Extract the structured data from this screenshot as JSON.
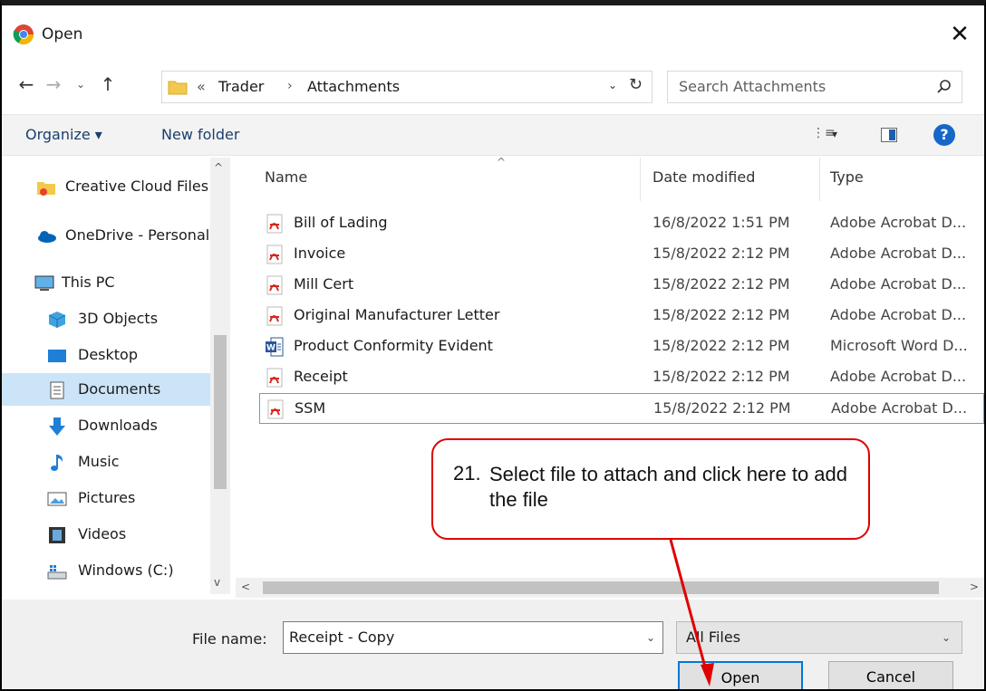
{
  "window": {
    "title": "Open",
    "close_glyph": "✕"
  },
  "address": {
    "overflow": "«",
    "path": [
      "Trader",
      "Attachments"
    ],
    "separator": "›",
    "dropdown_glyph": "⌄",
    "refresh_glyph": "↻"
  },
  "nav": {
    "back": "←",
    "forward": "→",
    "recent": "⌄",
    "up": "↑"
  },
  "search": {
    "placeholder": "Search Attachments"
  },
  "toolbar": {
    "organize": "Organize ▾",
    "new_folder": "New folder",
    "views_glyph": "⋮≡",
    "views_dd": "▾",
    "help": "?"
  },
  "sidebar": {
    "items": [
      {
        "label": "Creative Cloud Files",
        "icon": "creative-cloud-icon"
      },
      {
        "label": "OneDrive - Personal",
        "icon": "onedrive-icon"
      },
      {
        "label": "This PC",
        "icon": "pc-icon"
      },
      {
        "label": "3D Objects",
        "icon": "cube-icon"
      },
      {
        "label": "Desktop",
        "icon": "desktop-icon"
      },
      {
        "label": "Documents",
        "icon": "documents-icon"
      },
      {
        "label": "Downloads",
        "icon": "download-icon"
      },
      {
        "label": "Music",
        "icon": "music-icon"
      },
      {
        "label": "Pictures",
        "icon": "pictures-icon"
      },
      {
        "label": "Videos",
        "icon": "videos-icon"
      },
      {
        "label": "Windows (C:)",
        "icon": "drive-icon"
      }
    ],
    "selected": "Documents",
    "scroll_up": "^",
    "scroll_down": "v"
  },
  "columns": {
    "name": "Name",
    "date": "Date modified",
    "type": "Type",
    "sort_glyph": "^"
  },
  "files": [
    {
      "name": "Bill of Lading",
      "date": "16/8/2022 1:51 PM",
      "type": "Adobe Acrobat D...",
      "icon": "pdf-icon"
    },
    {
      "name": "Invoice",
      "date": "15/8/2022 2:12 PM",
      "type": "Adobe Acrobat D...",
      "icon": "pdf-icon"
    },
    {
      "name": "Mill Cert",
      "date": "15/8/2022 2:12 PM",
      "type": "Adobe Acrobat D...",
      "icon": "pdf-icon"
    },
    {
      "name": "Original Manufacturer Letter",
      "date": "15/8/2022 2:12 PM",
      "type": "Adobe Acrobat D...",
      "icon": "pdf-icon"
    },
    {
      "name": "Product Conformity Evident",
      "date": "15/8/2022 2:12 PM",
      "type": "Microsoft Word D...",
      "icon": "word-icon"
    },
    {
      "name": "Receipt",
      "date": "15/8/2022 2:12 PM",
      "type": "Adobe Acrobat D...",
      "icon": "pdf-icon"
    },
    {
      "name": "SSM",
      "date": "15/8/2022 2:12 PM",
      "type": "Adobe Acrobat D...",
      "icon": "pdf-icon"
    }
  ],
  "hscroll": {
    "left": "<",
    "right": ">"
  },
  "bottom": {
    "filename_label": "File name:",
    "filename_value": "Receipt - Copy",
    "filter_value": "All Files",
    "dd_glyph": "⌄",
    "open_label": "Open",
    "cancel_label": "Cancel"
  },
  "callout": {
    "number": "21.",
    "text": "Select file to attach and click here to add the file",
    "color": "#e00000"
  },
  "colors": {
    "accent": "#0078d7",
    "selected_bg": "#cce4f7",
    "pdf_red": "#d9261c",
    "word_blue": "#2b579a"
  }
}
